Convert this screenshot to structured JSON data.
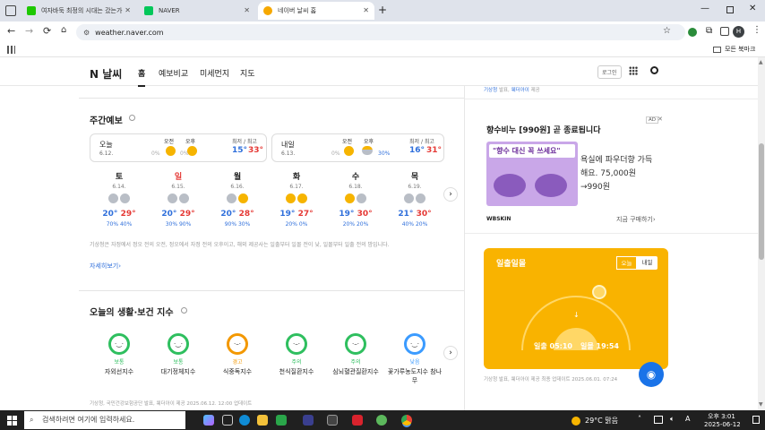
{
  "browser": {
    "tabs": [
      {
        "title": "여자바둑 최정의 시대는 갔는가",
        "fav": "#1ec800"
      },
      {
        "title": "NAVER",
        "fav": "#03c75a"
      },
      {
        "title": "네이버 날씨 홈",
        "fav": "#f6a800"
      }
    ],
    "url": "weather.naver.com",
    "bookmarks_label": "모든 북마크",
    "profile_initial": "H"
  },
  "nav": {
    "logo": "N 날씨",
    "items": [
      "홈",
      "예보비교",
      "미세먼지",
      "지도"
    ],
    "login": "로그인"
  },
  "top_source": {
    "src1": "기상청",
    "t1": "발표,",
    "src2": "웨더아이",
    "t2": "제공"
  },
  "weekly": {
    "title": "주간예보",
    "today": {
      "label": "오늘",
      "date": "6.12.",
      "am_label": "오전",
      "pm_label": "오후",
      "am_rain": "0%",
      "pm_rain": "0%",
      "minmax_label": "최저 / 최고",
      "min": "15°",
      "max": "33°"
    },
    "tomorrow": {
      "label": "내일",
      "date": "6.13.",
      "am_label": "오전",
      "pm_label": "오후",
      "am_rain": "0%",
      "pm_rain": "30%",
      "minmax_label": "최저 / 최고",
      "min": "16°",
      "max": "31°"
    },
    "days": [
      {
        "day": "토",
        "date": "6.14.",
        "min": "20°",
        "max": "29°",
        "am": "70%",
        "pm": "40%",
        "red": false
      },
      {
        "day": "일",
        "date": "6.15.",
        "min": "20°",
        "max": "29°",
        "am": "30%",
        "pm": "90%",
        "red": true
      },
      {
        "day": "월",
        "date": "6.16.",
        "min": "20°",
        "max": "28°",
        "am": "90%",
        "pm": "30%",
        "red": false
      },
      {
        "day": "화",
        "date": "6.17.",
        "min": "19°",
        "max": "27°",
        "am": "20%",
        "pm": "0%",
        "red": false
      },
      {
        "day": "수",
        "date": "6.18.",
        "min": "19°",
        "max": "30°",
        "am": "20%",
        "pm": "20%",
        "red": false
      },
      {
        "day": "목",
        "date": "6.19.",
        "min": "21°",
        "max": "30°",
        "am": "40%",
        "pm": "20%",
        "red": false
      }
    ],
    "note": "기상청은 자정에서 정오 전의 오전, 정오에서 자정 전의 오후이고, 해외 제공사는 일출부터 일몰 전이 낮, 일몰부터 일출 전의 밤입니다.",
    "more": "자세히보기"
  },
  "life": {
    "title": "오늘의 생활·보건 지수",
    "items": [
      {
        "status": "보통",
        "label": "자외선지수",
        "color": "#2fbf5f"
      },
      {
        "status": "보통",
        "label": "대기정체지수",
        "color": "#2fbf5f"
      },
      {
        "status": "경고",
        "label": "식중독지수",
        "color": "#f39800"
      },
      {
        "status": "주의",
        "label": "천식질환지수",
        "color": "#2fbf5f"
      },
      {
        "status": "주의",
        "label": "심뇌혈관질환지수",
        "color": "#2fbf5f"
      },
      {
        "status": "낮음",
        "label": "꽃가루농도지수 참나무",
        "color": "#3b9bff"
      }
    ],
    "source": "기상청, 국민건강보험공단 발표, 웨더아이 제공 2025.06.12. 12:00 업데이트"
  },
  "ad": {
    "title": "향수비누 [990원] 곧 종료됩니다",
    "badge": "AD",
    "banner": "\"향수 대신 꼭 쓰세요\"",
    "desc": "욕실에 파우더향 가득해요. 75,000원 →990원",
    "brand": "WBSKIN",
    "cta": "지금 구매하기"
  },
  "sun": {
    "title": "일출일몰",
    "tab_today": "오늘",
    "tab_tomorrow": "내일",
    "rise": "일출 05:10",
    "set": "일몰 19:54",
    "source": "기상청 발표, 웨더아이 제공 최종 업데이트 2025.06.01. 07:24"
  },
  "taskbar": {
    "search": "검색하려면 여기에 입력하세요.",
    "weather": "29°C 맑음",
    "time": "오후 3:01",
    "date": "2025-06-12"
  },
  "colors": {
    "accent": "#03c75a",
    "sun_card": "#f9b300",
    "ad_banner": "#c9a7e8"
  }
}
